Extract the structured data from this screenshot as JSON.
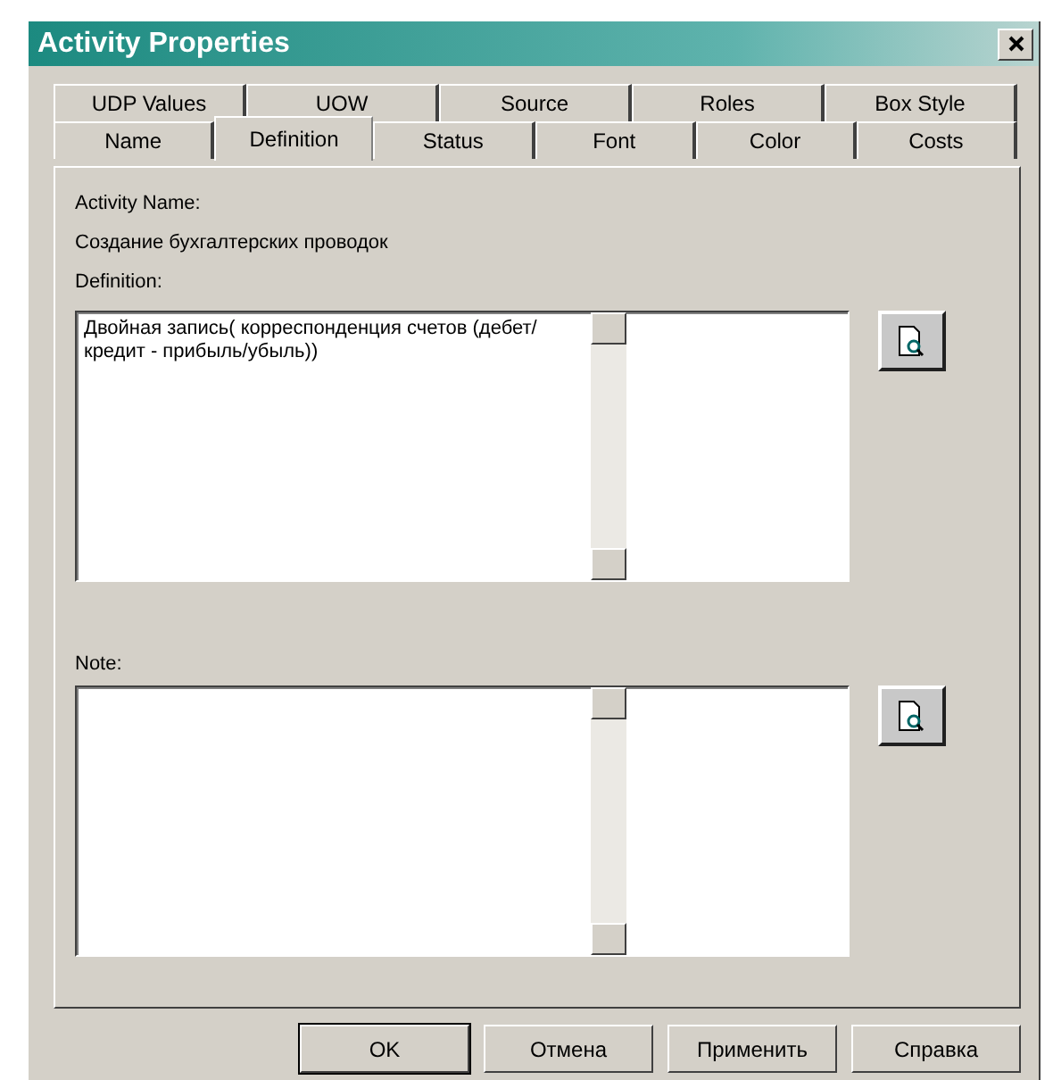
{
  "window": {
    "title": "Activity Properties"
  },
  "tab_rows": [
    [
      {
        "label": "UDP Values",
        "selected": false
      },
      {
        "label": "UOW",
        "selected": false
      },
      {
        "label": "Source",
        "selected": false
      },
      {
        "label": "Roles",
        "selected": false
      },
      {
        "label": "Box Style",
        "selected": false
      }
    ],
    [
      {
        "label": "Name",
        "selected": false
      },
      {
        "label": "Definition",
        "selected": true
      },
      {
        "label": "Status",
        "selected": false
      },
      {
        "label": "Font",
        "selected": false
      },
      {
        "label": "Color",
        "selected": false
      },
      {
        "label": "Costs",
        "selected": false
      }
    ]
  ],
  "activity_name": {
    "label": "Activity Name:",
    "value": "Создание бухгалтерских проводок"
  },
  "definition": {
    "label": "Definition:",
    "value": "Двойная запись( корреспонденция счетов (дебет/ кредит - прибыль/убыль))"
  },
  "note": {
    "label": "Note:"
  },
  "buttons": [
    "OK",
    "Отмена",
    "Применить",
    "Справка"
  ]
}
